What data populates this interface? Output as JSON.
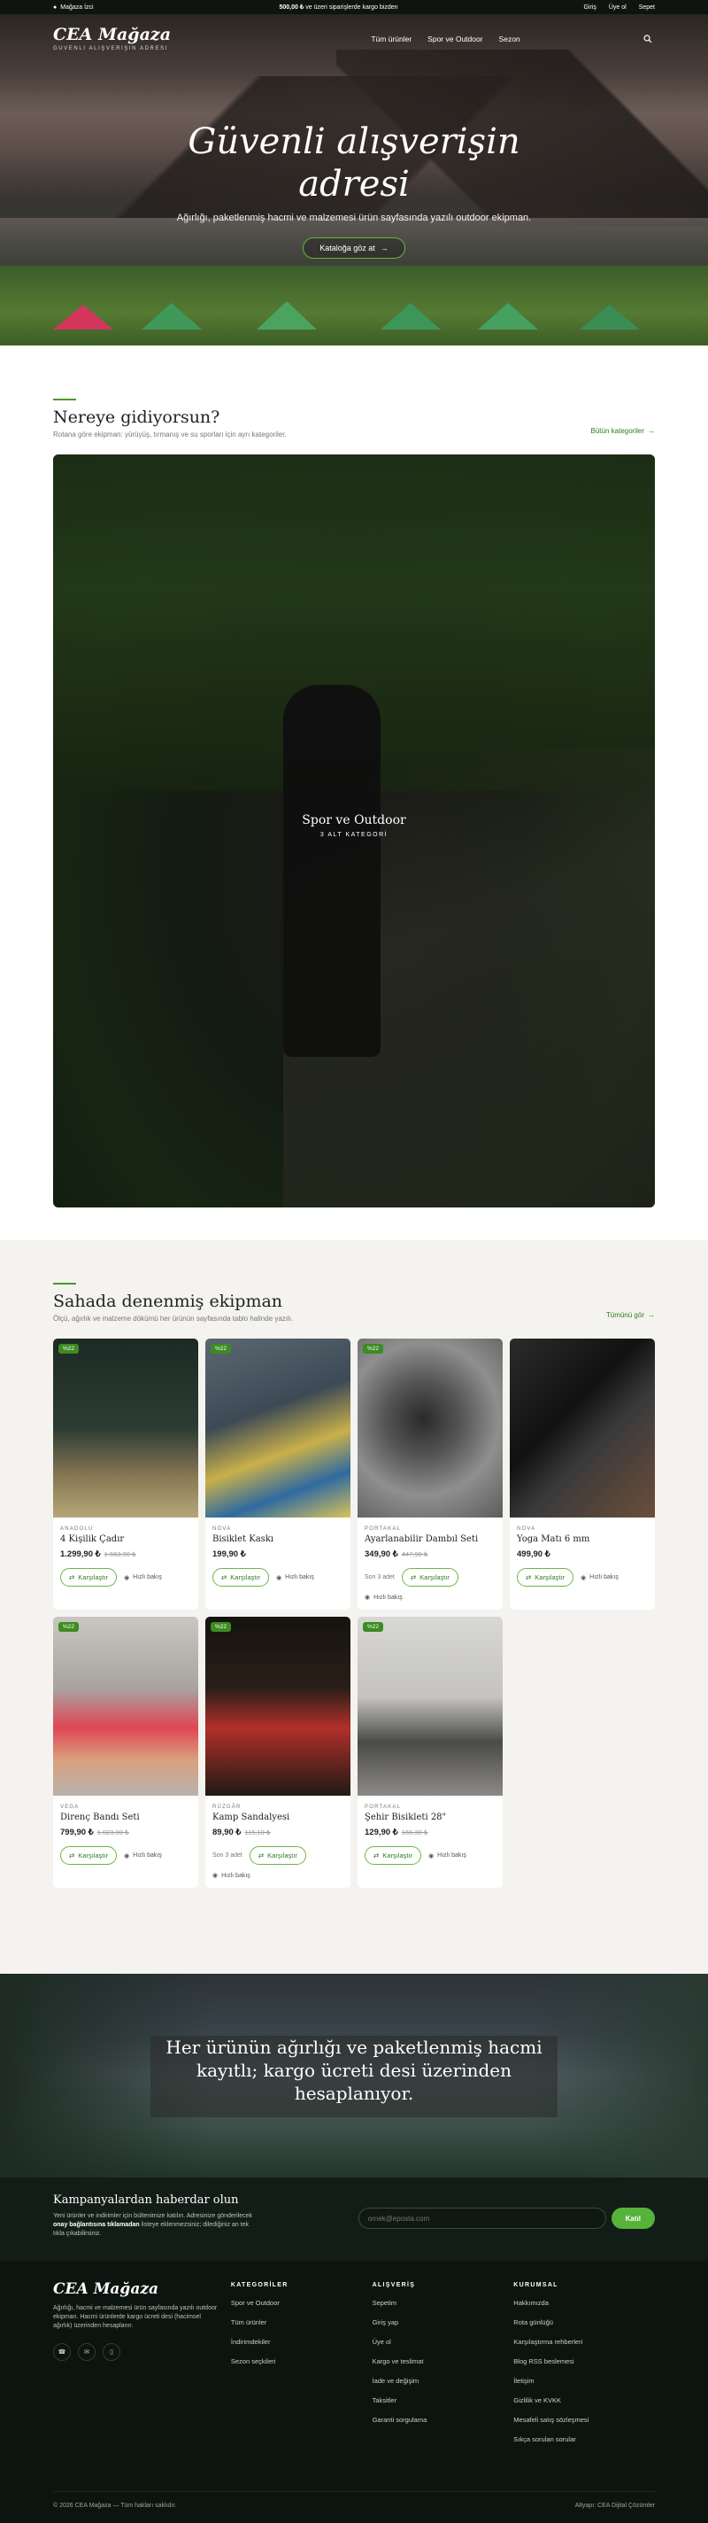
{
  "topbar": {
    "location": "Mağaza İzci",
    "shipping_amount": "500,00 ₺",
    "shipping_text": " ve üzeri siparişlerde kargo bizden",
    "login": "Giriş",
    "register": "Üye ol",
    "cart": "Sepet"
  },
  "header": {
    "logo": "CEA Mağaza",
    "tagline": "GÜVENLİ ALIŞVERİŞİN ADRESİ",
    "nav": [
      "Tüm ürünler",
      "Spor ve Outdoor",
      "Sezon"
    ]
  },
  "hero": {
    "title_line1": "Güvenli alışverişin",
    "title_line2": "adresi",
    "subtitle": "Ağırlığı, paketlenmiş hacmi ve malzemesi ürün sayfasında yazılı outdoor ekipman.",
    "cta": "Kataloğa göz at"
  },
  "destinations": {
    "title": "Nereye gidiyorsun?",
    "subtitle": "Rotana göre ekipman: yürüyüş, tırmanış ve su sporları için ayrı kategoriler.",
    "link": "Bütün kategoriler",
    "card_title": "Spor ve Outdoor",
    "card_sub": "3 ALT KATEGORİ"
  },
  "products": {
    "title": "Sahada denenmiş ekipman",
    "subtitle": "Ölçü, ağırlık ve malzeme dökümü her ürünün sayfasında tablo halinde yazılı.",
    "link": "Tümünü gör",
    "compare_label": "Karşılaştır",
    "quick_label": "Hızlı bakış",
    "items": [
      {
        "badge": "%22",
        "brand": "ANADOLU",
        "name": "4 Kişilik Çadır",
        "price": "1.299,90 ₺",
        "old": "1.663,90 ₺",
        "stock": ""
      },
      {
        "badge": "%22",
        "brand": "NOVA",
        "name": "Bisiklet Kaskı",
        "price": "199,90 ₺",
        "old": "",
        "stock": ""
      },
      {
        "badge": "%22",
        "brand": "PORTAKAL",
        "name": "Ayarlanabilir Dambıl Seti",
        "price": "349,90 ₺",
        "old": "447,90 ₺",
        "stock": "Son 3 adet"
      },
      {
        "badge": "",
        "brand": "NOVA",
        "name": "Yoga Matı 6 mm",
        "price": "499,90 ₺",
        "old": "",
        "stock": ""
      },
      {
        "badge": "%22",
        "brand": "VEGA",
        "name": "Direnç Bandı Seti",
        "price": "799,90 ₺",
        "old": "1.023,90 ₺",
        "stock": ""
      },
      {
        "badge": "%22",
        "brand": "RÜZGÂR",
        "name": "Kamp Sandalyesi",
        "price": "89,90 ₺",
        "old": "115,10 ₺",
        "stock": "Son 3 adet"
      },
      {
        "badge": "%22",
        "brand": "PORTAKAL",
        "name": "Şehir Bisikleti 28\"",
        "price": "129,90 ₺",
        "old": "166,30 ₺",
        "stock": ""
      }
    ]
  },
  "banner": {
    "line1": "Her ürünün ağırlığı ve paketlenmiş hacmi",
    "line2": "kayıtlı; kargo ücreti desi üzerinden",
    "line3": "hesaplanıyor."
  },
  "newsletter": {
    "title": "Kampanyalardan haberdar olun",
    "text_a": "Yeni ürünler ve indirimler için bültenimize katılın. Adresinize gönderilecek ",
    "text_bold": "onay bağlantısına tıklamadan",
    "text_b": " listeye eklenmezsiniz; dilediğiniz an tek tıkla çıkabilirsiniz.",
    "placeholder": "ornek@eposta.com",
    "button": "Katıl"
  },
  "footer": {
    "logo": "CEA Mağaza",
    "about": "Ağırlığı, hacmi ve malzemesi ürün sayfasında yazılı outdoor ekipman. Hacmi ürünlerde kargo ücreti desi (hacimsel ağırlık) üzerinden hesaplanır.",
    "col1_title": "KATEGORİLER",
    "col1": [
      "Spor ve Outdoor",
      "Tüm ürünler",
      "İndirimdekiler",
      "Sezon seçkileri"
    ],
    "col2_title": "ALIŞVERİŞ",
    "col2": [
      "Sepetim",
      "Giriş yap",
      "Üye ol",
      "Kargo ve teslimat",
      "İade ve değişim",
      "Taksitler",
      "Garanti sorgulama"
    ],
    "col3_title": "KURUMSAL",
    "col3": [
      "Hakkımızda",
      "Rota günlüğü",
      "Karşılaştırma rehberleri",
      "Blog RSS beslemesi",
      "İletişim",
      "Gizlilik ve KVKK",
      "Mesafeli satış sözleşmesi",
      "Sıkça sorulan sorular"
    ],
    "copyright": "© 2026 CEA Mağaza — Tüm hakları saklıdır.",
    "credit": "Altyapı: CEA Dijital Çözümler"
  }
}
